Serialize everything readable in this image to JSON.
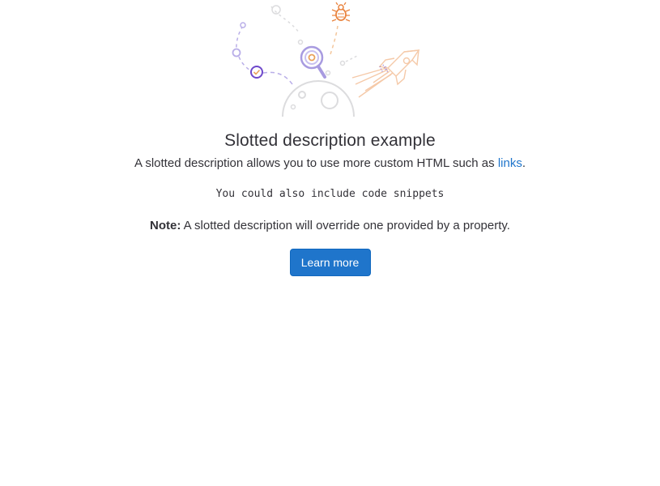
{
  "empty_state": {
    "illustration_icon": "empty-state-search-bug-rocket-illustration",
    "title": "Slotted description example",
    "description": {
      "text_before_link": "A slotted description allows you to use more custom HTML such as ",
      "link_text": "links",
      "text_after_link": "."
    },
    "code_snippet": "You could also include code snippets",
    "note": {
      "label": "Note:",
      "text": " A slotted description will override one provided by a property."
    },
    "primary_button_label": "Learn more"
  },
  "colors": {
    "primary": "#1f75cb",
    "link": "#1f75cb",
    "text": "#333238",
    "illustration_purple": "#a89be0",
    "illustration_orange": "#e9a25c",
    "illustration_gray": "#dcdcde"
  }
}
